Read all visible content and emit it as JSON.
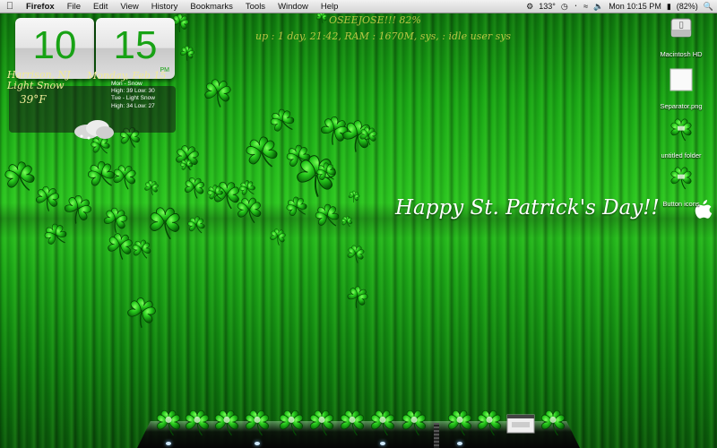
{
  "menubar": {
    "app": "Firefox",
    "menus": [
      "File",
      "Edit",
      "View",
      "History",
      "Bookmarks",
      "Tools",
      "Window",
      "Help"
    ],
    "status": {
      "temp": "133°",
      "datetime": "Mon 10:15 PM",
      "battery": "(82%)"
    }
  },
  "clock_widget": {
    "hours": "10",
    "minutes": "15",
    "ampm": "PM",
    "location": "Harrison, NJ",
    "condition": "Light Snow",
    "temperature": "39°F",
    "date": "Monday, Feb 15",
    "forecast": [
      "Mon - Snow",
      "High: 39 Low: 30",
      "Tue - Light Snow",
      "High: 34 Low: 27"
    ]
  },
  "sysinfo": {
    "line1": "OSEEJOSE!!! 82%",
    "line2": "up : 1 day, 21:42, RAM : 1670M, sys, : idle user sys"
  },
  "greeting": "Happy St. Patrick's Day!!",
  "desktop_icons": [
    {
      "label": "Macintosh HD",
      "icon": "hard-drive-icon"
    },
    {
      "label": "Separator.png",
      "icon": "image-file-icon"
    },
    {
      "label": "untitled folder",
      "icon": "shamrock-folder-icon"
    },
    {
      "label": "Button icons",
      "icon": "shamrock-folder-icon"
    }
  ],
  "dock": {
    "items": [
      {
        "name": "finder",
        "icon": "shamrock-finder-icon"
      },
      {
        "name": "mail",
        "icon": "shamrock-mail-icon"
      },
      {
        "name": "safari",
        "icon": "shamrock-globe-icon"
      },
      {
        "name": "firefox",
        "icon": "shamrock-firefox-icon"
      },
      {
        "name": "photos",
        "icon": "shamrock-camera-icon"
      },
      {
        "name": "itunes",
        "icon": "shamrock-headphones-icon"
      },
      {
        "name": "textedit",
        "icon": "shamrock-pencil-icon"
      },
      {
        "name": "system-preferences",
        "icon": "shamrock-gear-icon"
      },
      {
        "name": "iphoto",
        "icon": "shamrock-photos-icon"
      },
      {
        "name": "applications",
        "icon": "shamrock-folder-icon"
      },
      {
        "name": "documents",
        "icon": "shamrock-folder-icon"
      },
      {
        "name": "preview-window",
        "icon": "window-thumbnail-icon"
      },
      {
        "name": "trash",
        "icon": "shamrock-trash-icon"
      }
    ]
  },
  "colors": {
    "accent_green": "#18a215",
    "shamrock": "#1fc81a",
    "sysinfo_text": "#d6d24f",
    "weather_text": "#f0ea9a"
  }
}
